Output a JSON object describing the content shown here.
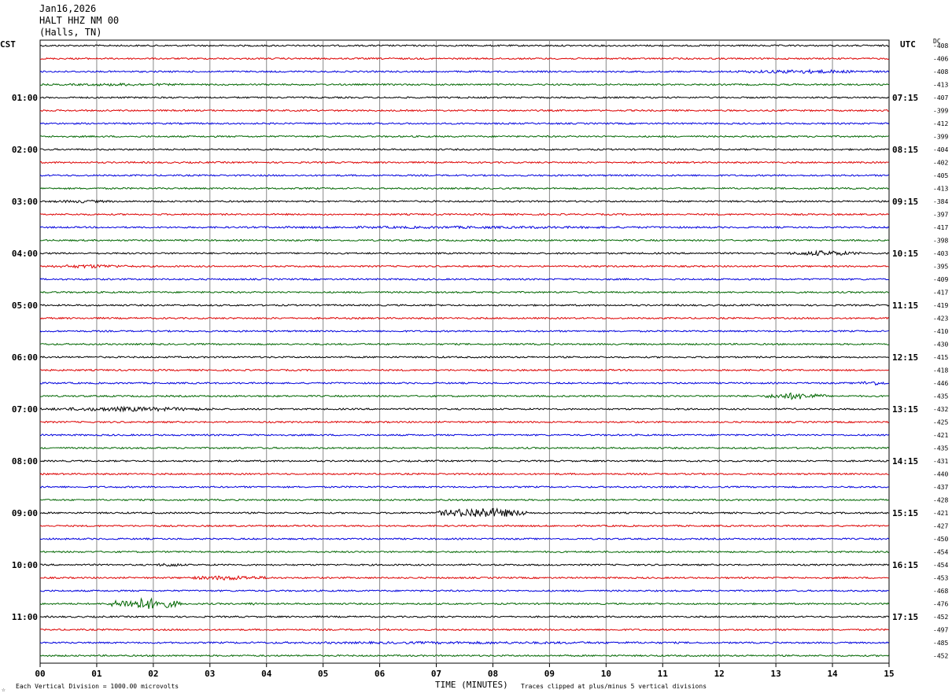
{
  "header": {
    "date": "Jan16,2026",
    "station": "HALT HHZ NM 00",
    "location": "(Halls, TN)"
  },
  "left_tz": "CST",
  "right_tz": "UTC",
  "dc_label": "DC",
  "footer": {
    "scale": "Each Vertical Division = 1000.00 microvolts",
    "xlabel": "TIME (MINUTES)",
    "clip_note": "Traces clipped at plus/minus 5 vertical divisions"
  },
  "chart_data": {
    "type": "line",
    "title": "",
    "xlabel": "TIME (MINUTES)",
    "ylabel": "",
    "x_ticks": [
      "00",
      "01",
      "02",
      "03",
      "04",
      "05",
      "06",
      "07",
      "08",
      "09",
      "10",
      "11",
      "12",
      "13",
      "14",
      "15"
    ],
    "xlim": [
      0,
      15
    ],
    "grid": true,
    "trace_colors": [
      "#000000",
      "#dd0000",
      "#0000dd",
      "#006600"
    ],
    "left_hour_labels": [
      "01:00",
      "02:00",
      "03:00",
      "04:00",
      "05:00",
      "06:00",
      "07:00",
      "08:00",
      "09:00",
      "10:00",
      "11:00"
    ],
    "right_hour_labels": [
      "07:15",
      "08:15",
      "09:15",
      "10:15",
      "11:15",
      "12:15",
      "13:15",
      "14:15",
      "15:15",
      "16:15",
      "17:15"
    ],
    "dc_offsets": [
      "-408",
      "-406",
      "-408",
      "-413",
      "-407",
      "-399",
      "-412",
      "-399",
      "-404",
      "-402",
      "-405",
      "-413",
      "-384",
      "-397",
      "-417",
      "-398",
      "-403",
      "-395",
      "-409",
      "-417",
      "-419",
      "-423",
      "-410",
      "-430",
      "-415",
      "-418",
      "-446",
      "-435",
      "-432",
      "-425",
      "-421",
      "-435",
      "-431",
      "-440",
      "-437",
      "-428",
      "-421",
      "-427",
      "-450",
      "-454",
      "-454",
      "-453",
      "-468",
      "-476",
      "-452",
      "-497",
      "-485",
      "-452"
    ]
  }
}
